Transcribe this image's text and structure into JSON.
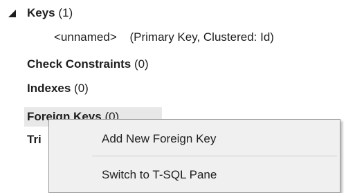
{
  "tree": {
    "keys": {
      "label": "Keys",
      "count": "(1)"
    },
    "keys_child": {
      "name": "<unnamed>",
      "detail": "(Primary Key, Clustered: Id)"
    },
    "check_constraints": {
      "label": "Check Constraints",
      "count": "(0)"
    },
    "indexes": {
      "label": "Indexes",
      "count": "(0)"
    },
    "foreign_keys": {
      "label": "Foreign Keys",
      "count": "(0)"
    },
    "triggers": {
      "label": "Tri"
    }
  },
  "context_menu": {
    "items": [
      {
        "label": "Add New Foreign Key"
      },
      {
        "label": "Switch to T-SQL Pane"
      }
    ]
  }
}
